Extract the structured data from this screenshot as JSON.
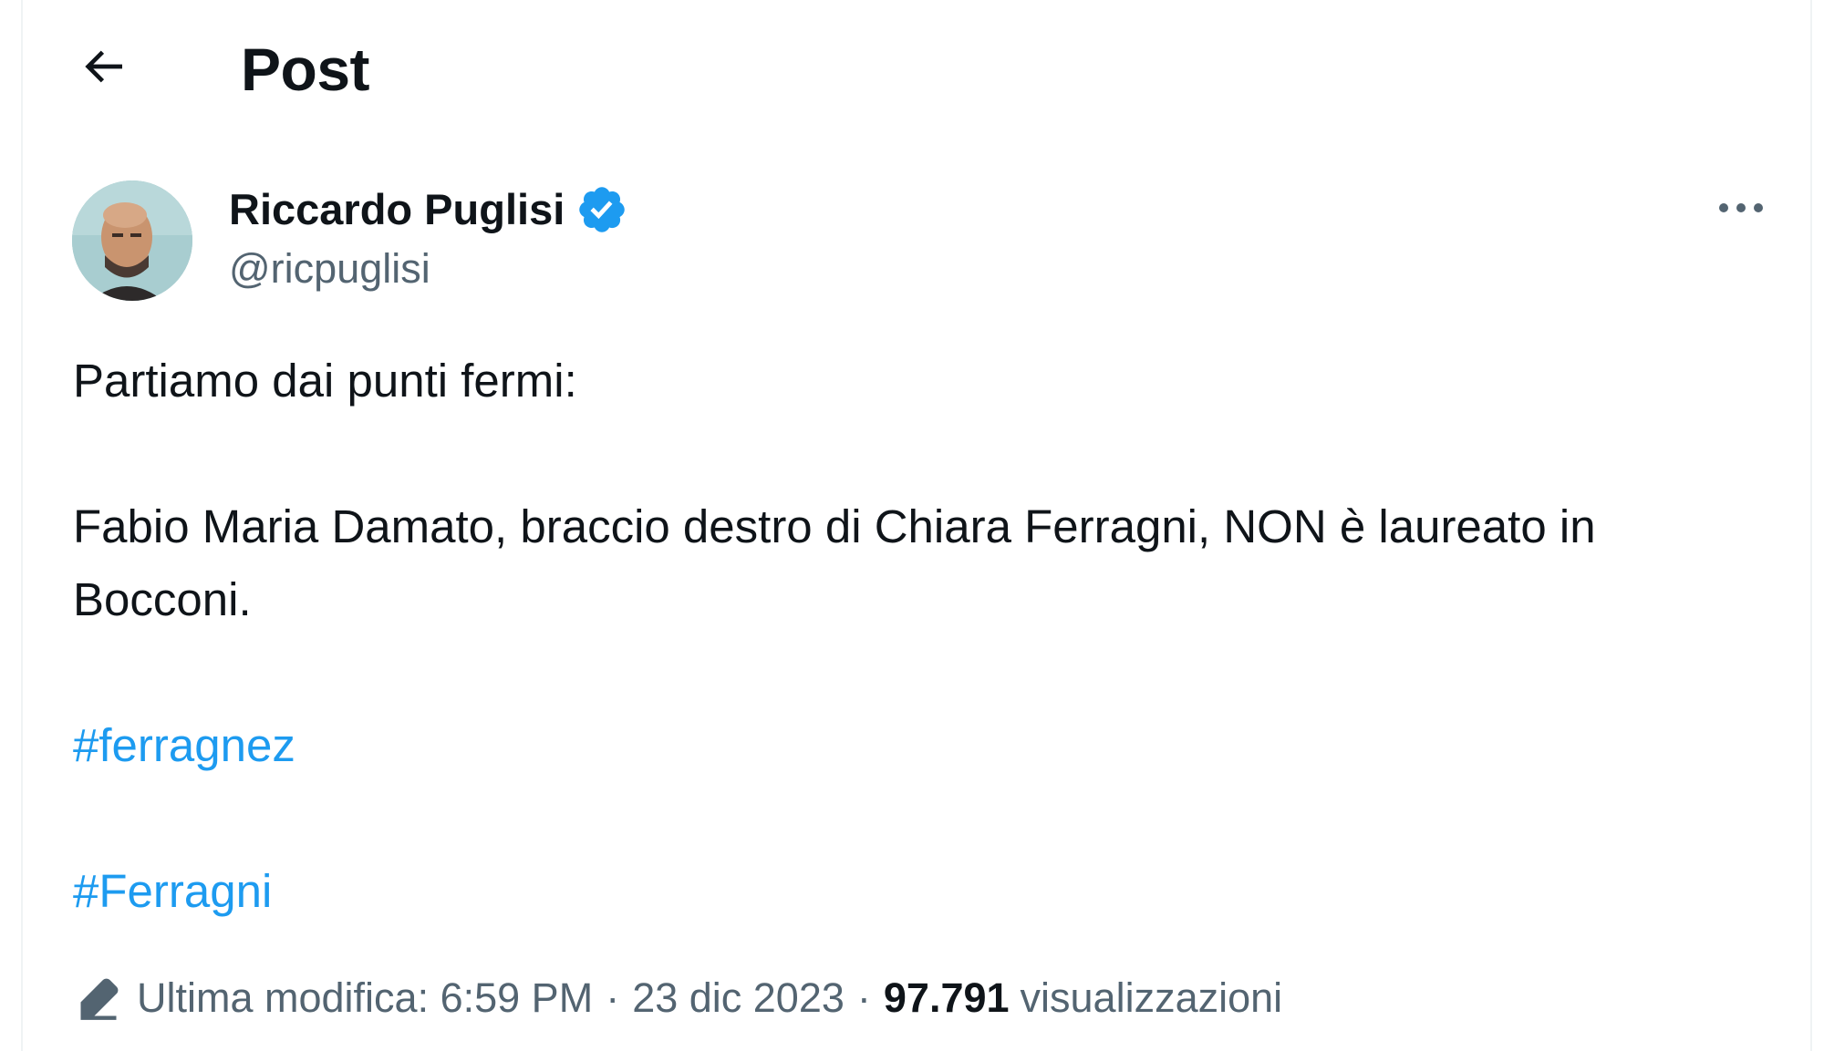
{
  "header": {
    "title": "Post"
  },
  "author": {
    "name": "Riccardo Puglisi",
    "handle": "@ricpuglisi",
    "verified": true
  },
  "tweet": {
    "line1": "Partiamo dai punti fermi:",
    "line2": "Fabio Maria Damato, braccio destro di Chiara Ferragni, NON è laureato in",
    "line3": "Bocconi.",
    "hashtags": [
      "#ferragnez",
      "#Ferragni"
    ]
  },
  "meta": {
    "edited_label": "Ultima modifica:",
    "time": "6:59 PM",
    "separator": "·",
    "date": "23 dic 2023",
    "views_count": "97.791",
    "views_label": "visualizzazioni"
  },
  "colors": {
    "accent": "#1d9bf0",
    "text": "#0f1419",
    "secondary": "#536471"
  },
  "icons": {
    "back": "arrow-left-icon",
    "verified": "verified-badge-icon",
    "more": "more-dots-icon",
    "edited": "pencil-edit-icon"
  }
}
